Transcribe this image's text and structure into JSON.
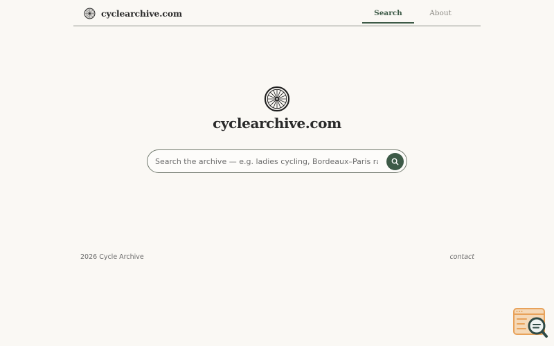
{
  "header": {
    "brand_name": "cyclearchive.com",
    "brand_icon": "wheel-icon",
    "nav": [
      {
        "label": "Search",
        "active": true
      },
      {
        "label": "About",
        "active": false
      }
    ]
  },
  "hero": {
    "icon": "wheel-icon",
    "title": "cyclearchive.com"
  },
  "search": {
    "value": "",
    "placeholder": "Search the archive — e.g. ladies cycling, Bordeaux–Paris race, v",
    "button_icon": "search-icon"
  },
  "footer": {
    "copyright": "2026 Cycle Archive",
    "contact_label": "contact"
  },
  "corner_widget": {
    "icon": "inspect-page-icon"
  },
  "colors": {
    "background": "#faf8f4",
    "accent": "#3d5a47",
    "widget": "#e8a25a"
  }
}
